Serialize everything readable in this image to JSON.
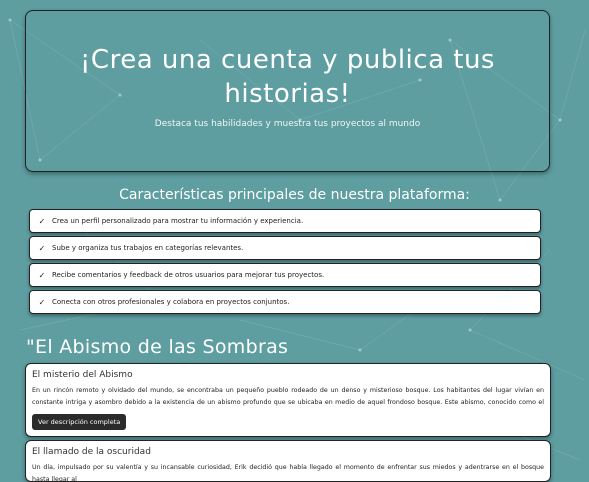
{
  "hero": {
    "title": "¡Crea una cuenta y publica tus historias!",
    "subtitle": "Destaca tus habilidades y muestra tus proyectos al mundo"
  },
  "features": {
    "title": "Características principales de nuestra plataforma:",
    "items": [
      {
        "icon": "check-icon",
        "text": "Crea un perfil personalizado para mostrar tu información y experiencia."
      },
      {
        "icon": "check-icon",
        "text": "Sube y organiza tus trabajos en categorías relevantes."
      },
      {
        "icon": "check-icon",
        "text": "Recibe comentarios y feedback de otros usuarios para mejorar tus proyectos."
      },
      {
        "icon": "check-icon",
        "text": "Conecta con otros profesionales y colabora en proyectos conjuntos."
      }
    ]
  },
  "stories": {
    "title": "\"El Abismo de las Sombras",
    "items": [
      {
        "title": "El misterio del Abismo",
        "description": "En un rincón remoto y olvidado del mundo, se encontraba un pequeño pueblo rodeado de un denso y misterioso bosque. Los habitantes del lugar vivían en constante intriga y asombro debido a la existencia de un abismo profundo que se ubicaba en medio de aquel frondoso bosque. Este abismo, conocido como el Abismo de las Sombras,",
        "button": "Ver descripción completa"
      },
      {
        "title": "El llamado de la oscuridad",
        "description": "Un día, impulsado por su valentía y su incansable curiosidad, Erik decidió que había llegado el momento de enfrentar sus miedos y adentrarse en el bosque hasta llegar al"
      }
    ]
  },
  "colors": {
    "background": "#5e9da0",
    "card": "#ffffff",
    "button": "#2b2b2b"
  }
}
